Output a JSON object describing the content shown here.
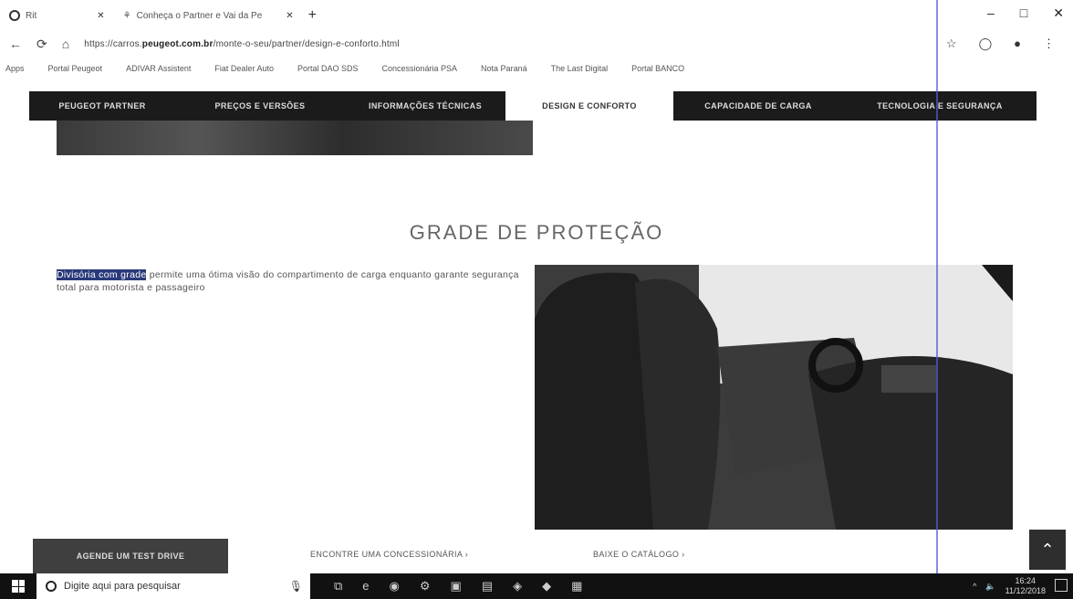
{
  "browser": {
    "tabs": [
      {
        "label": "Rit"
      },
      {
        "label": "Conheça o Partner e Vai da Pe"
      }
    ],
    "url_prefix": "https://carros.",
    "url_domain": "peugeot.com.br",
    "url_rest": "/monte-o-seu/partner/design-e-conforto.html",
    "bookmarks": [
      "Apps",
      "Portal Peugeot",
      "ADIVAR Assistent",
      "Fiat Dealer Auto",
      "Portal DAO SDS",
      "Concessionária PSA",
      "Nota Paraná",
      "The Last Digital",
      "Portal BANCO"
    ]
  },
  "nav": {
    "items": [
      "PEUGEOT PARTNER",
      "PREÇOS E VERSÕES",
      "INFORMAÇÕES TÉCNICAS",
      "DESIGN E CONFORTO",
      "CAPACIDADE DE CARGA",
      "TECNOLOGIA E SEGURANÇA"
    ]
  },
  "section": {
    "title": "GRADE DE PROTEÇÃO",
    "highlight": "Divisória com grade",
    "description": " permite uma ótima visão do compartimento de carga enquanto garante segurança total para motorista e passageiro"
  },
  "footer": {
    "test_drive": "AGENDE UM TEST DRIVE",
    "dealer": "ENCONTRE UMA CONCESSIONÁRIA",
    "catalog": "BAIXE O CATÁLOGO"
  },
  "taskbar": {
    "search_placeholder": "Digite aqui para pesquisar",
    "time": "16:24",
    "date": "11/12/2018"
  }
}
